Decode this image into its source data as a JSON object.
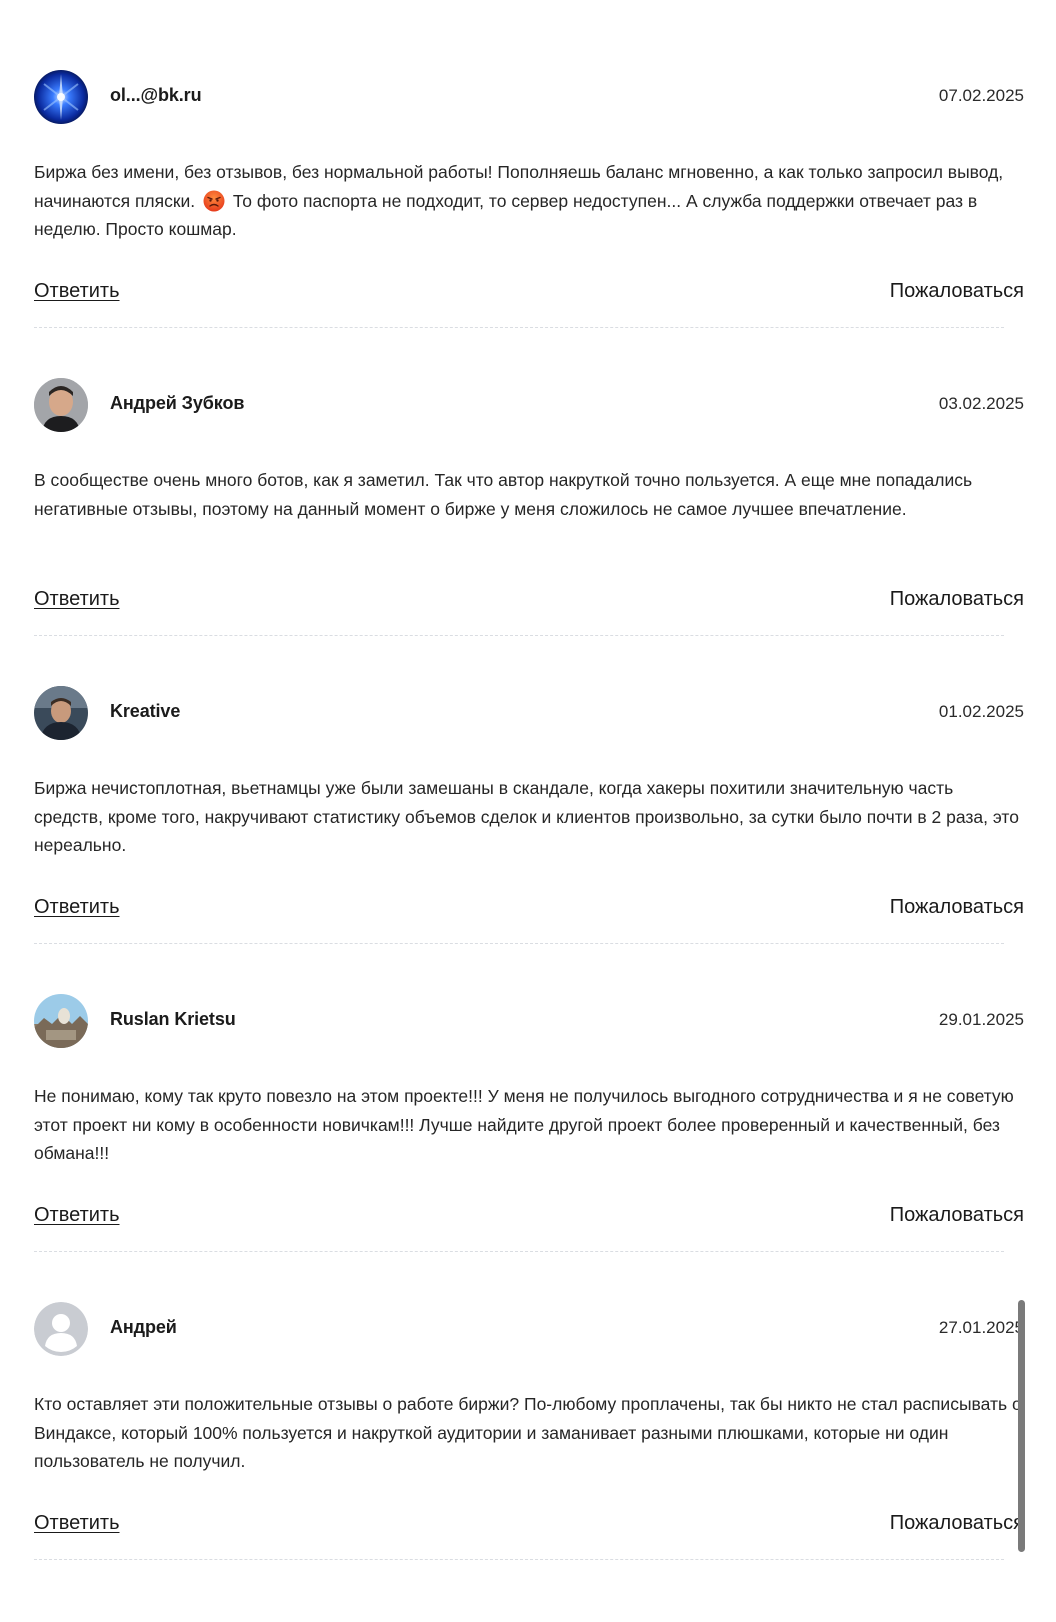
{
  "reviews": [
    {
      "author": "ol...@bk.ru",
      "date": "07.02.2025",
      "text_before_emoji": "Биржа без имени, без отзывов, без нормальной работы! Пополняешь баланс мгновенно, а как только запросил вывод, начинаются пляски.",
      "emoji": "angry-face-emoji",
      "text_after_emoji": "То фото паспорта не подходит, то сервер недоступен... А служба поддержки отвечает раз в неделю. Просто кошмар.",
      "reply_label": "Ответить",
      "complain_label": "Пожаловаться"
    },
    {
      "author": "Андрей Зубков",
      "date": "03.02.2025",
      "text": "В сообществе очень много ботов, как я заметил. Так что автор накруткой точно пользуется. А еще мне попадались негативные отзывы, поэтому на данный момент о бирже у меня сложилось не самое лучшее впечатление.",
      "reply_label": "Ответить",
      "complain_label": "Пожаловаться"
    },
    {
      "author": "Kreative",
      "date": "01.02.2025",
      "text": "Биржа нечистоплотная, вьетнамцы уже были замешаны в скандале, когда хакеры похитили значительную часть средств, кроме того, накручивают статистику объемов сделок и клиентов произвольно, за сутки было почти в 2 раза, это нереально.",
      "reply_label": "Ответить",
      "complain_label": "Пожаловаться"
    },
    {
      "author": "Ruslan Krietsu",
      "date": "29.01.2025",
      "text": "Не понимаю, кому так круто повезло на этом проекте!!! У меня не получилось выгодного сотрудничества и я не советую этот проект ни кому в особенности новичкам!!! Лучше найдите другой проект более проверенный и качественный, без обмана!!!",
      "reply_label": "Ответить",
      "complain_label": "Пожаловаться"
    },
    {
      "author": "Андрей",
      "date": "27.01.2025",
      "text": "Кто оставляет эти положительные отзывы о работе биржи? По-любому проплачены, так бы никто не стал расписывать о Виндаксе, который 100% пользуется и накруткой аудитории и заманивает разными плюшками, которые ни один пользователь не получил.",
      "reply_label": "Ответить",
      "complain_label": "Пожаловаться"
    }
  ],
  "colors": {
    "text": "#262626",
    "divider": "#dadde2",
    "default_avatar": "#c9ccd2"
  }
}
